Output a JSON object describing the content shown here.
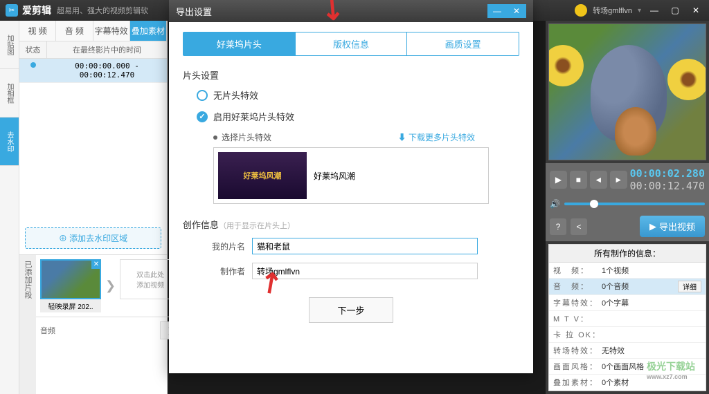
{
  "titlebar": {
    "app_name": "爱剪辑",
    "tagline": "超易用、强大的视频剪辑软",
    "username": "转场gmlflvn"
  },
  "tabs": {
    "video": "视 频",
    "audio": "音 频",
    "subtitle": "字幕特效",
    "overlay": "叠加素材"
  },
  "table": {
    "status_h": "状态",
    "time_h": "在最终影片中的时间",
    "row1_time": "00:00:00.000 - 00:00:12.470"
  },
  "left_tools": {
    "t1": "加贴图",
    "t2": "加相框",
    "t3": "去水印"
  },
  "watermark_btn": "添加去水印区域",
  "added_label": "已添加片段",
  "clip": {
    "name": "轻映录屏 202..",
    "add": "双击此处\n添加视频",
    "audio": "音频"
  },
  "dialog": {
    "title": "导出设置",
    "tabs": {
      "t1": "好莱坞片头",
      "t2": "版权信息",
      "t3": "画质设置"
    },
    "section1": "片头设置",
    "opt1": "无片头特效",
    "opt2": "启用好莱坞片头特效",
    "subopt": "选择片头特效",
    "download": "下载更多片头特效",
    "effect_thumb": "好莱坞风潮",
    "effect_name": "好莱坞风潮",
    "section2": "创作信息",
    "section2_hint": "（用于显示在片头上）",
    "label_name": "我的片名",
    "input_name": "猫和老鼠",
    "label_author": "制作者",
    "input_author": "转场gmlflvn",
    "next": "下一步"
  },
  "player": {
    "current": "00:00:02.280",
    "total": "00:00:12.470",
    "export": "导出视频"
  },
  "info": {
    "title": "所有制作的信息：",
    "video_k": "视　频：",
    "video_v": "1个视频",
    "audio_k": "音　频：",
    "audio_v": "0个音频",
    "detail": "详细",
    "sub_k": "字幕特效：",
    "sub_v": "0个字幕",
    "mtv_k": "M T V：",
    "kara_k": "卡 拉 OK：",
    "trans_k": "转场特效：",
    "trans_v": "无特效",
    "style_k": "画面风格：",
    "style_v": "0个画面风格",
    "overlay_k": "叠加素材：",
    "overlay_v": "0个素材"
  },
  "watermark": {
    "site": "极光下载站",
    "url": "www.xz7.com"
  }
}
